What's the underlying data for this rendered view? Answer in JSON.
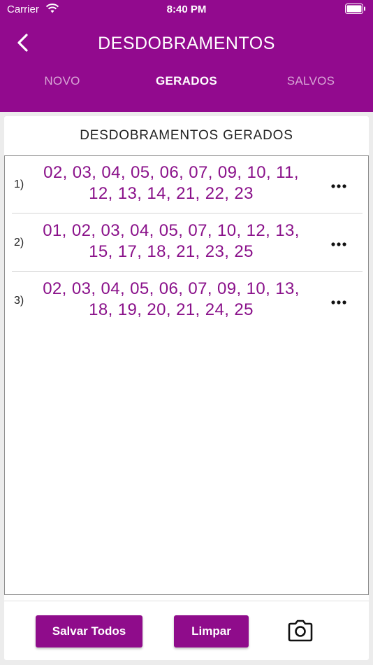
{
  "status_bar": {
    "carrier": "Carrier",
    "time": "8:40 PM"
  },
  "header": {
    "title": "DESDOBRAMENTOS"
  },
  "tabs": [
    {
      "label": "NOVO",
      "active": false
    },
    {
      "label": "GERADOS",
      "active": true
    },
    {
      "label": "SALVOS",
      "active": false
    }
  ],
  "section": {
    "title": "DESDOBRAMENTOS GERADOS"
  },
  "results": [
    {
      "index": "1)",
      "numbers": "02, 03, 04, 05, 06, 07, 09, 10, 11, 12, 13, 14, 21, 22, 23"
    },
    {
      "index": "2)",
      "numbers": "01, 02, 03, 04, 05, 07, 10, 12, 13, 15, 17, 18, 21, 23, 25"
    },
    {
      "index": "3)",
      "numbers": "02, 03, 04, 05, 06, 07, 09, 10, 13, 18, 19, 20, 21, 24, 25"
    }
  ],
  "footer": {
    "save_all_label": "Salvar Todos",
    "clear_label": "Limpar"
  },
  "colors": {
    "primary": "#920a8e",
    "numbers": "#8a118a"
  }
}
